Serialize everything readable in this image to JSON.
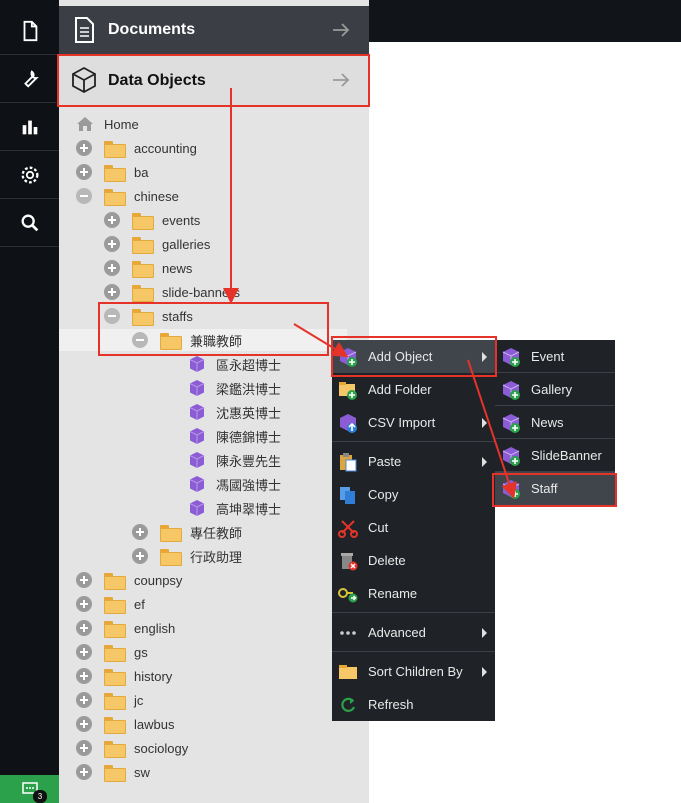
{
  "sidebar": {
    "icons": [
      "document-icon",
      "wrench-icon",
      "bar-chart-icon",
      "gear-icon",
      "search-icon"
    ],
    "chat_badge": "3"
  },
  "headers": {
    "documents": "Documents",
    "data_objects": "Data Objects"
  },
  "tree": {
    "home": "Home",
    "top_folders": [
      "accounting",
      "ba",
      "chinese"
    ],
    "chinese_children": [
      "events",
      "galleries",
      "news",
      "slide-banners",
      "staffs"
    ],
    "staffs_child": "兼職教師",
    "staff_objects": [
      "區永超博士",
      "梁鑑洪博士",
      "沈惠英博士",
      "陳德錦博士",
      "陳永豐先生",
      "馮國強博士",
      "高坤翠博士"
    ],
    "staffs_more": [
      "專任教師",
      "行政助理"
    ],
    "bottom_folders": [
      "counpsy",
      "ef",
      "english",
      "gs",
      "history",
      "jc",
      "lawbus",
      "sociology",
      "sw"
    ]
  },
  "context_menu": {
    "items": [
      "Add Object",
      "Add Folder",
      "CSV Import",
      "Paste",
      "Copy",
      "Cut",
      "Delete",
      "Rename",
      "Advanced",
      "Sort Children By",
      "Refresh"
    ]
  },
  "submenu": {
    "items": [
      "Event",
      "Gallery",
      "News",
      "SlideBanner",
      "Staff"
    ]
  },
  "colors": {
    "annotation": "#e5332a",
    "menu_bg": "#1f2327",
    "folder": "#f5c766",
    "object_cube": "#8b5cd6",
    "add_badge": "#2aa14a"
  }
}
